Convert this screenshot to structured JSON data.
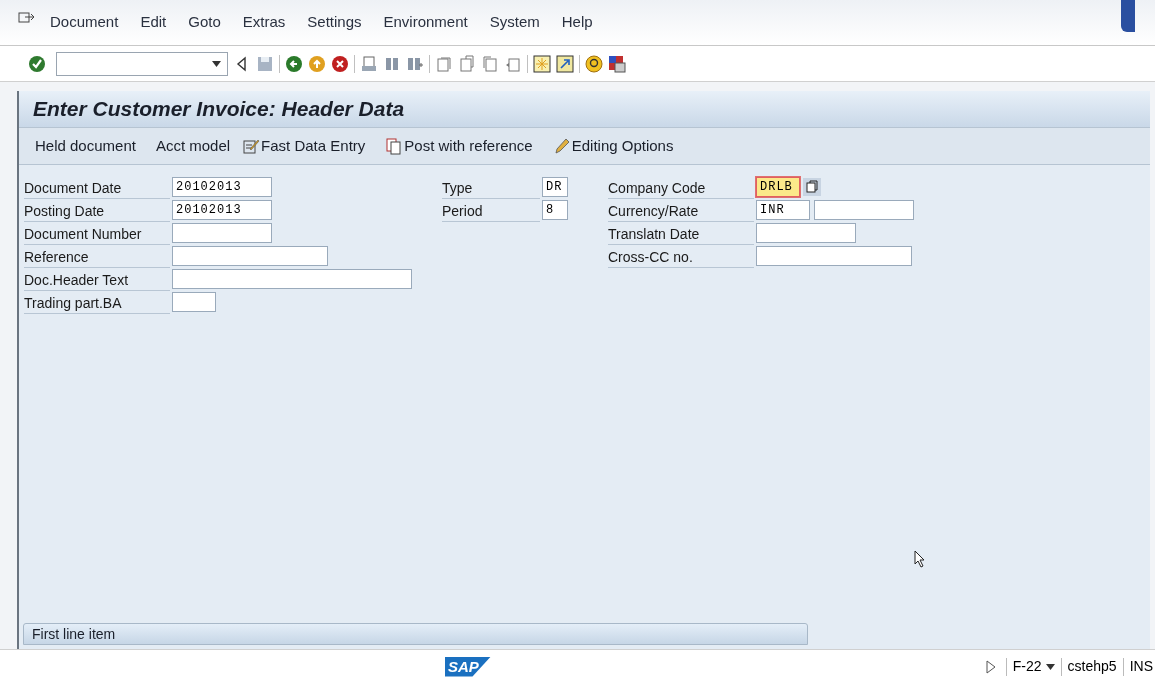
{
  "menu": [
    {
      "label": "Document"
    },
    {
      "label": "Edit"
    },
    {
      "label": "Goto"
    },
    {
      "label": "Extras"
    },
    {
      "label": "Settings"
    },
    {
      "label": "Environment"
    },
    {
      "label": "System"
    },
    {
      "label": "Help"
    }
  ],
  "title": "Enter Customer Invoice: Header Data",
  "app_toolbar": [
    {
      "label": "Held document",
      "kind": "plain"
    },
    {
      "label": "Acct model",
      "kind": "plain"
    },
    {
      "label": "Fast Data Entry",
      "kind": "fast-entry"
    },
    {
      "label": "Post with reference",
      "kind": "post-reference"
    },
    {
      "label": "Editing Options",
      "kind": "pencil"
    }
  ],
  "form_left": [
    {
      "label": "Document Date",
      "value": "20102013"
    },
    {
      "label": "Posting Date",
      "value": "20102013"
    },
    {
      "label": "Document Number"
    },
    {
      "label": "Reference"
    },
    {
      "label": "Doc.Header Text"
    },
    {
      "label": "Trading part.BA"
    }
  ],
  "form_middle": [
    {
      "label": "Type",
      "value": "DR"
    },
    {
      "label": "Period",
      "value": "8"
    }
  ],
  "form_right": [
    {
      "label": "Company Code",
      "value": "DRLB",
      "focused": true
    },
    {
      "label": "Currency/Rate",
      "value": "INR",
      "focused": false
    },
    {
      "label": "Translatn Date",
      "focused": false
    },
    {
      "label": "Cross-CC no.",
      "focused": false
    }
  ],
  "section_title": "First line item",
  "status_bar": {
    "logo": "SAP",
    "transaction": "F-22",
    "server": "cstehp5",
    "mode": "INS"
  }
}
